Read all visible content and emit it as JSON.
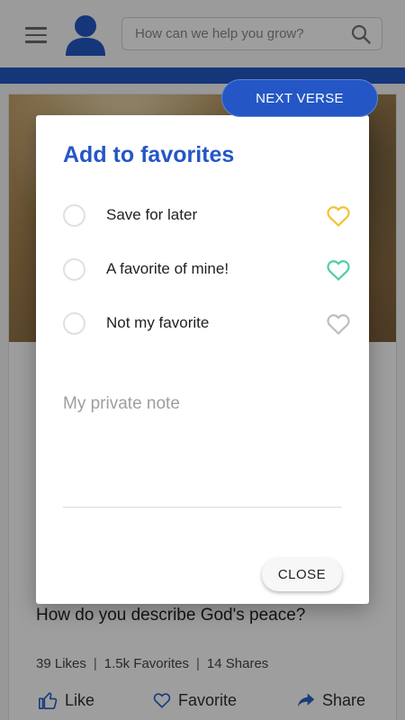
{
  "header": {
    "search_placeholder": "How can we help you grow?"
  },
  "card": {
    "next_verse_label": "NEXT VERSE",
    "question": "How do you describe God's peace?",
    "stats": {
      "likes": "39 Likes",
      "favorites": "1.5k Favorites",
      "shares": "14 Shares",
      "separator": "|"
    },
    "actions": {
      "like": "Like",
      "favorite": "Favorite",
      "share": "Share"
    }
  },
  "dialog": {
    "title": "Add to favorites",
    "options": [
      {
        "label": "Save for later",
        "heart_color": "#f2c331"
      },
      {
        "label": "A favorite of mine!",
        "heart_color": "#4fcf9e"
      },
      {
        "label": "Not my favorite",
        "heart_color": "#bdbdbd"
      }
    ],
    "note_placeholder": "My private note",
    "close_label": "CLOSE"
  },
  "colors": {
    "brand_blue": "#2457c5",
    "action_blue": "#2a5fc9"
  }
}
